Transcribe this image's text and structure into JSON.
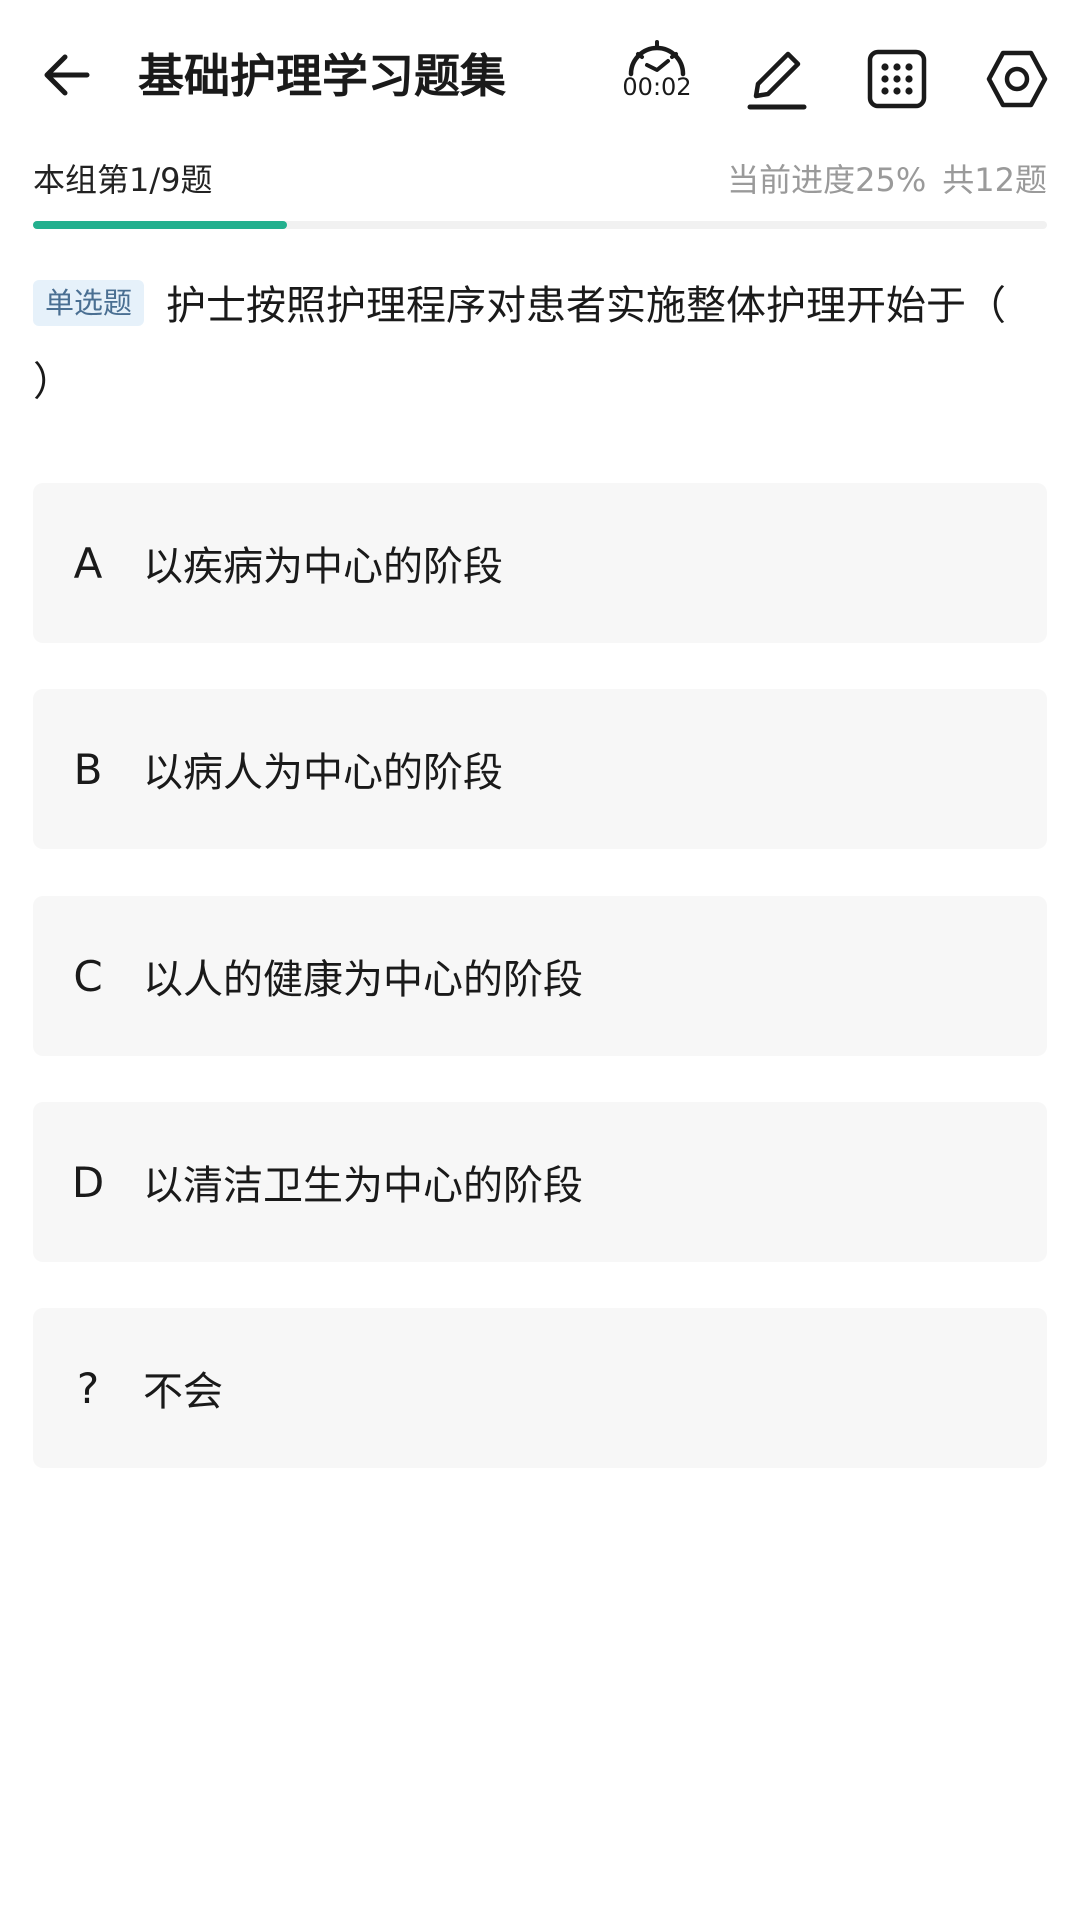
{
  "header": {
    "title": "基础护理学习题集",
    "timer": "00:02",
    "icons": [
      "back-arrow-icon",
      "timer-icon",
      "pen-icon",
      "grid-icon",
      "settings-icon"
    ]
  },
  "status": {
    "position": "本组第1/9题",
    "progress_label": "当前进度25%",
    "total_label": "共12题",
    "progress_fraction": 0.25,
    "progress_color": "#23b08e"
  },
  "question": {
    "type_badge": "单选题",
    "text": "护士按照护理程序对患者实施整体护理开始于（    ）"
  },
  "options": [
    {
      "key": "A",
      "text": "以疾病为中心的阶段"
    },
    {
      "key": "B",
      "text": "以病人为中心的阶段"
    },
    {
      "key": "C",
      "text": "以人的健康为中心的阶段"
    },
    {
      "key": "D",
      "text": "以清洁卫生为中心的阶段"
    },
    {
      "key": "?",
      "text": "不会"
    }
  ]
}
